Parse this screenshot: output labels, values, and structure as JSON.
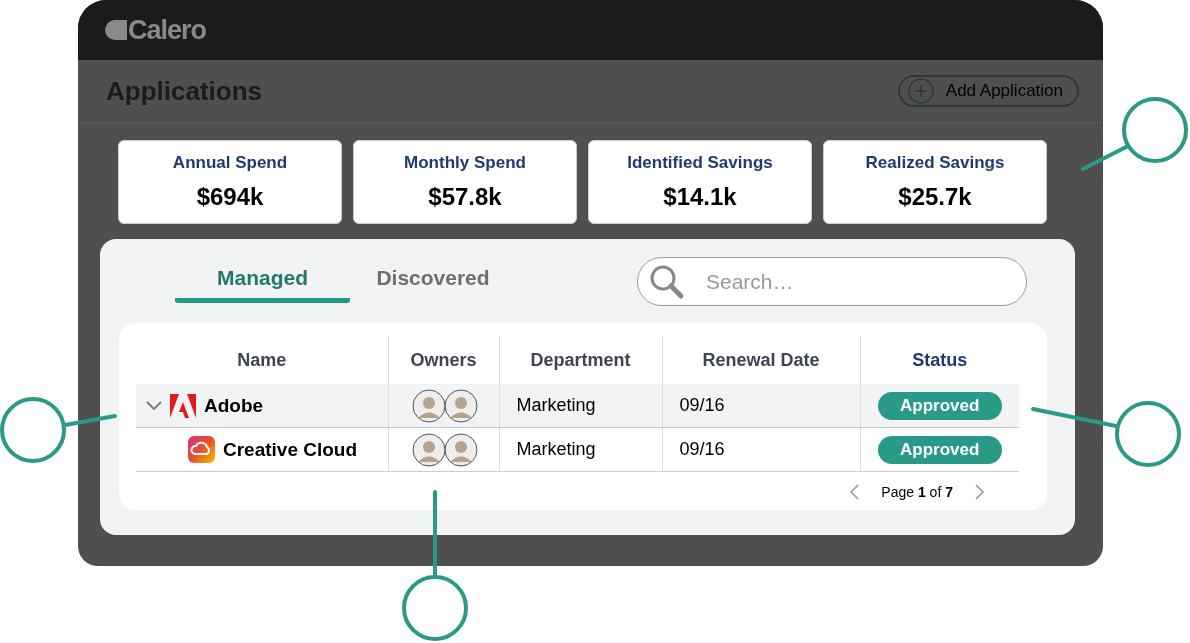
{
  "header": {
    "logo": "Calero"
  },
  "page": {
    "title": "Applications",
    "add_button": "Add Application"
  },
  "metrics": [
    {
      "label": "Annual Spend",
      "value": "$694k"
    },
    {
      "label": "Monthly Spend",
      "value": "$57.8k"
    },
    {
      "label": "Identified Savings",
      "value": "$14.1k"
    },
    {
      "label": "Realized Savings",
      "value": "$25.7k"
    }
  ],
  "tabs": [
    {
      "label": "Managed",
      "selected": true
    },
    {
      "label": "Discovered",
      "selected": false
    }
  ],
  "search": {
    "placeholder": "Search…"
  },
  "table": {
    "columns": [
      {
        "label": "Name",
        "sorted": false
      },
      {
        "label": "Owners",
        "sorted": false
      },
      {
        "label": "Department",
        "sorted": false
      },
      {
        "label": "Renewal Date",
        "sorted": false
      },
      {
        "label": "Status",
        "sorted": true
      }
    ],
    "rows": [
      {
        "name": "Adobe",
        "kind": "vendor",
        "expanded": true,
        "selected": true,
        "department": "Marketing",
        "renewal": "09/16",
        "status": "Approved",
        "children": [
          {
            "name": "Creative Cloud",
            "kind": "product",
            "selected": false,
            "department": "Marketing",
            "renewal": "09/16",
            "status": "Approved"
          }
        ]
      }
    ]
  },
  "pagination": {
    "text": "Page **1** of **7**"
  }
}
